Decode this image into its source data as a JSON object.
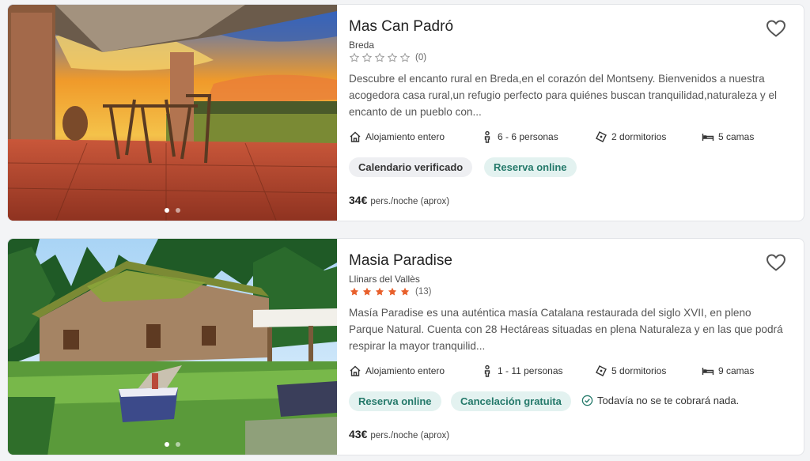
{
  "listings": [
    {
      "title": "Mas Can Padró",
      "location": "Breda",
      "rating_count": "(0)",
      "stars_filled": 0,
      "description": "Descubre el encanto rural en Breda,en el corazón del Montseny. Bienvenidos a nuestra acogedora casa rural,un refugio perfecto para quiénes buscan tranquilidad,naturaleza y el encanto de un pueblo con...",
      "features": {
        "type": "Alojamiento entero",
        "guests": "6 - 6 personas",
        "bedrooms": "2 dormitorios",
        "beds": "5 camas"
      },
      "tags": [
        "Calendario verificado",
        "Reserva online"
      ],
      "price": "34€",
      "price_unit": "pers./noche (aprox)",
      "photo_icon": "terrace-sunset-photo"
    },
    {
      "title": "Masia Paradise",
      "location": "Llinars del Vallès",
      "rating_count": "(13)",
      "stars_filled": 5,
      "description": "Masía Paradise es una auténtica masía Catalana restaurada del siglo XVII, en pleno Parque Natural. Cuenta con 28 Hectáreas situadas en plena Naturaleza y en las que podrá respirar la mayor tranquilid...",
      "features": {
        "type": "Alojamiento entero",
        "guests": "1 - 11 personas",
        "bedrooms": "5 dormitorios",
        "beds": "9 camas"
      },
      "tags": [
        "Reserva online",
        "Cancelación gratuita"
      ],
      "notice": "Todavía no se te cobrará nada.",
      "price": "43€",
      "price_unit": "pers./noche (aprox)",
      "photo_icon": "stone-farmhouse-photo"
    }
  ],
  "colors": {
    "star_filled": "#e8602c",
    "star_empty": "#9a9a9a",
    "tag_green_text": "#24796a",
    "tag_green_bg": "#e3f2f0",
    "tag_gray_bg": "#eeeff2"
  }
}
